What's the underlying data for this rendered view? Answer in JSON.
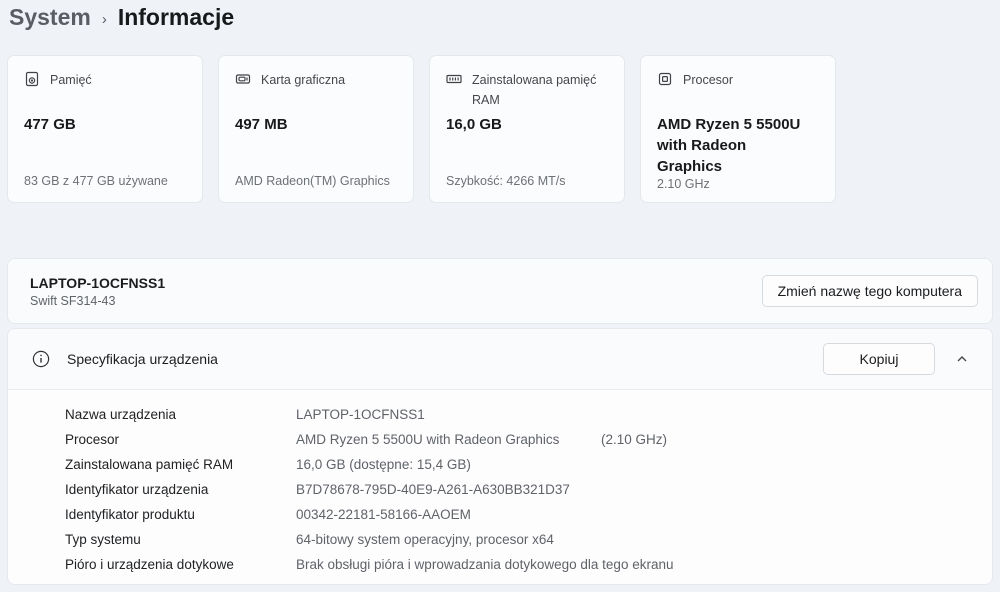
{
  "breadcrumb": {
    "parent": "System",
    "separator": "›",
    "current": "Informacje"
  },
  "cards": [
    {
      "icon": "storage-icon",
      "label": "Pamięć",
      "value": "477 GB",
      "subtitle": "83 GB z 477 GB używane"
    },
    {
      "icon": "gpu-icon",
      "label": "Karta graficzna",
      "value": "497 MB",
      "subtitle": "AMD Radeon(TM) Graphics"
    },
    {
      "icon": "ram-icon",
      "label": "Zainstalowana pamięć RAM",
      "value": "16,0 GB",
      "subtitle": "Szybkość: 4266 MT/s"
    },
    {
      "icon": "cpu-icon",
      "label": "Procesor",
      "value": "AMD Ryzen 5 5500U with Radeon Graphics",
      "subtitle": "2.10 GHz"
    }
  ],
  "device": {
    "name": "LAPTOP-1OCFNSS1",
    "model": "Swift SF314-43",
    "rename_button": "Zmień nazwę tego komputera"
  },
  "spec_section": {
    "icon": "info-icon",
    "title": "Specyfikacja urządzenia",
    "copy_button": "Kopiuj",
    "expander_state_icon": "chevron-up-icon",
    "rows": [
      {
        "label": "Nazwa urządzenia",
        "value": "LAPTOP-1OCFNSS1",
        "extra": ""
      },
      {
        "label": "Procesor",
        "value": "AMD Ryzen 5 5500U with Radeon Graphics",
        "extra": "(2.10 GHz)"
      },
      {
        "label": "Zainstalowana pamięć RAM",
        "value": "16,0 GB (dostępne: 15,4 GB)",
        "extra": ""
      },
      {
        "label": "Identyfikator urządzenia",
        "value": "B7D78678-795D-40E9-A261-A630BB321D37",
        "extra": ""
      },
      {
        "label": "Identyfikator produktu",
        "value": "00342-22181-58166-AAOEM",
        "extra": ""
      },
      {
        "label": "Typ systemu",
        "value": "64-bitowy system operacyjny, procesor x64",
        "extra": ""
      },
      {
        "label": "Pióro i urządzenia dotykowe",
        "value": "Brak obsługi pióra i wprowadzania dotykowego dla tego ekranu",
        "extra": ""
      }
    ]
  },
  "colors": {
    "page_background": "#eff3f7",
    "card_background": "#fbfcfd",
    "card_border": "#e4e8ec",
    "text_primary": "#17191b",
    "text_secondary": "#5f6368"
  }
}
